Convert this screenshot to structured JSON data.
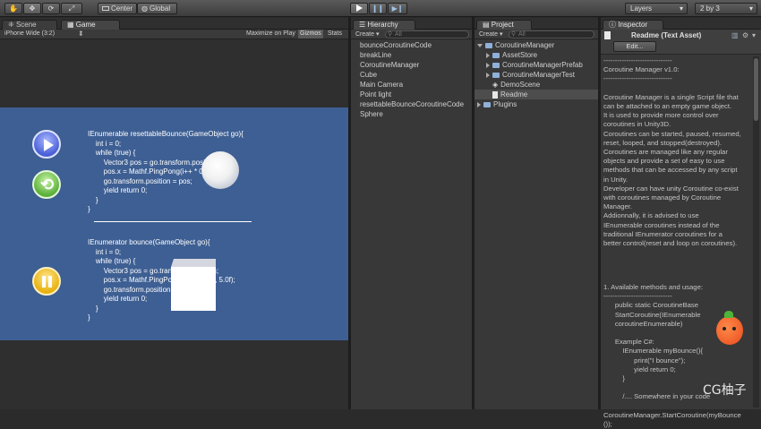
{
  "toolbar": {
    "tools": [
      "hand-icon",
      "move-icon",
      "rotate-icon",
      "scale-icon"
    ],
    "pivot_center": "Center",
    "pivot_global": "Global",
    "layers": "Layers",
    "layout": "2 by 3"
  },
  "scene_tab": "Scene",
  "game_tab": "Game",
  "game_bar": {
    "aspect": "iPhone Wide (3:2)",
    "maximize": "Maximize on Play",
    "gizmos": "Gizmos",
    "stats": "Stats"
  },
  "game_view": {
    "bg": "#3e5f93",
    "code1": [
      "IEnumerable resettableBounce(GameObject go){",
      "    int i = 0;",
      "    while (true) {",
      "        Vector3 pos = go.transform.position;",
      "        pos.x = Mathf.PingPong(i++ * 0.0f);",
      "        go.transform.position = pos;",
      "        yield return 0;",
      "    }",
      "}"
    ],
    "code2": [
      "IEnumerator bounce(GameObject go){",
      "    int i = 0;",
      "    while (true) {",
      "        Vector3 pos = go.transform.position;",
      "        pos.x = Mathf.PingPong(i++ * 0.50f, 5.0f);",
      "        go.transform.position = pos;",
      "        yield return 0;",
      "    }",
      "}"
    ]
  },
  "hierarchy": {
    "title": "Hierarchy",
    "create": "Create",
    "search": "All",
    "items": [
      "bounceCoroutineCode",
      "breakLine",
      "CoroutineManager",
      "Cube",
      "Main Camera",
      "Point light",
      "resettableBounceCoroutineCode",
      "Sphere"
    ]
  },
  "project": {
    "title": "Project",
    "create": "Create",
    "search": "All",
    "items": [
      {
        "label": "CoroutineManager",
        "kind": "folder",
        "depth": 0,
        "open": true
      },
      {
        "label": "AssetStore",
        "kind": "folder",
        "depth": 1,
        "open": false
      },
      {
        "label": "CoroutineManagerPrefab",
        "kind": "folder",
        "depth": 1,
        "open": false
      },
      {
        "label": "CoroutineManagerTest",
        "kind": "folder",
        "depth": 1,
        "open": false
      },
      {
        "label": "DemoScene",
        "kind": "scene",
        "depth": 1,
        "open": false
      },
      {
        "label": "Readme",
        "kind": "doc",
        "depth": 1,
        "open": false,
        "selected": true
      },
      {
        "label": "Plugins",
        "kind": "folder",
        "depth": 0,
        "open": false
      }
    ]
  },
  "inspector": {
    "title": "Inspector",
    "asset_title": "Readme (Text Asset)",
    "edit_button": "Edit...",
    "body": "------------------------------\nCoroutine Manager v1.0:\n------------------------------\n\nCoroutine Manager is a single Script file that\ncan be attached to an empty game object.\nIt is used to provide more control over\ncoroutines in Unity3D.\nCoroutines can be started, paused, resumed,\nreset, looped, and stopped(destroyed).\nCoroutines are managed like any regular\nobjects and provide a set of easy to use\nmethods that can be accessed by any script\nin Unity.\nDeveloper can have unity Coroutine co-exist\nwith coroutines managed by Coroutine\nManager.\nAddionnally, it is advised to use\nIEnumerable coroutines instead of the\ntraditional IEnumerator coroutines for a\nbetter control(reset and loop on coroutines).",
    "body2": "1. Available methods and usage:\n------------------------------\n      public static CoroutineBase\n      StartCoroutine(IEnumerable\n      coroutineEnumerable)\n\n      Example C#:\n          IEnumerable myBounce(){\n                print(\"I bounce\");\n                yield return 0;\n          }\n\n          /.... Somewhere in your code\n\nCoroutineManager.StartCoroutine(myBounce\n());"
  },
  "watermark": "CG柚子"
}
